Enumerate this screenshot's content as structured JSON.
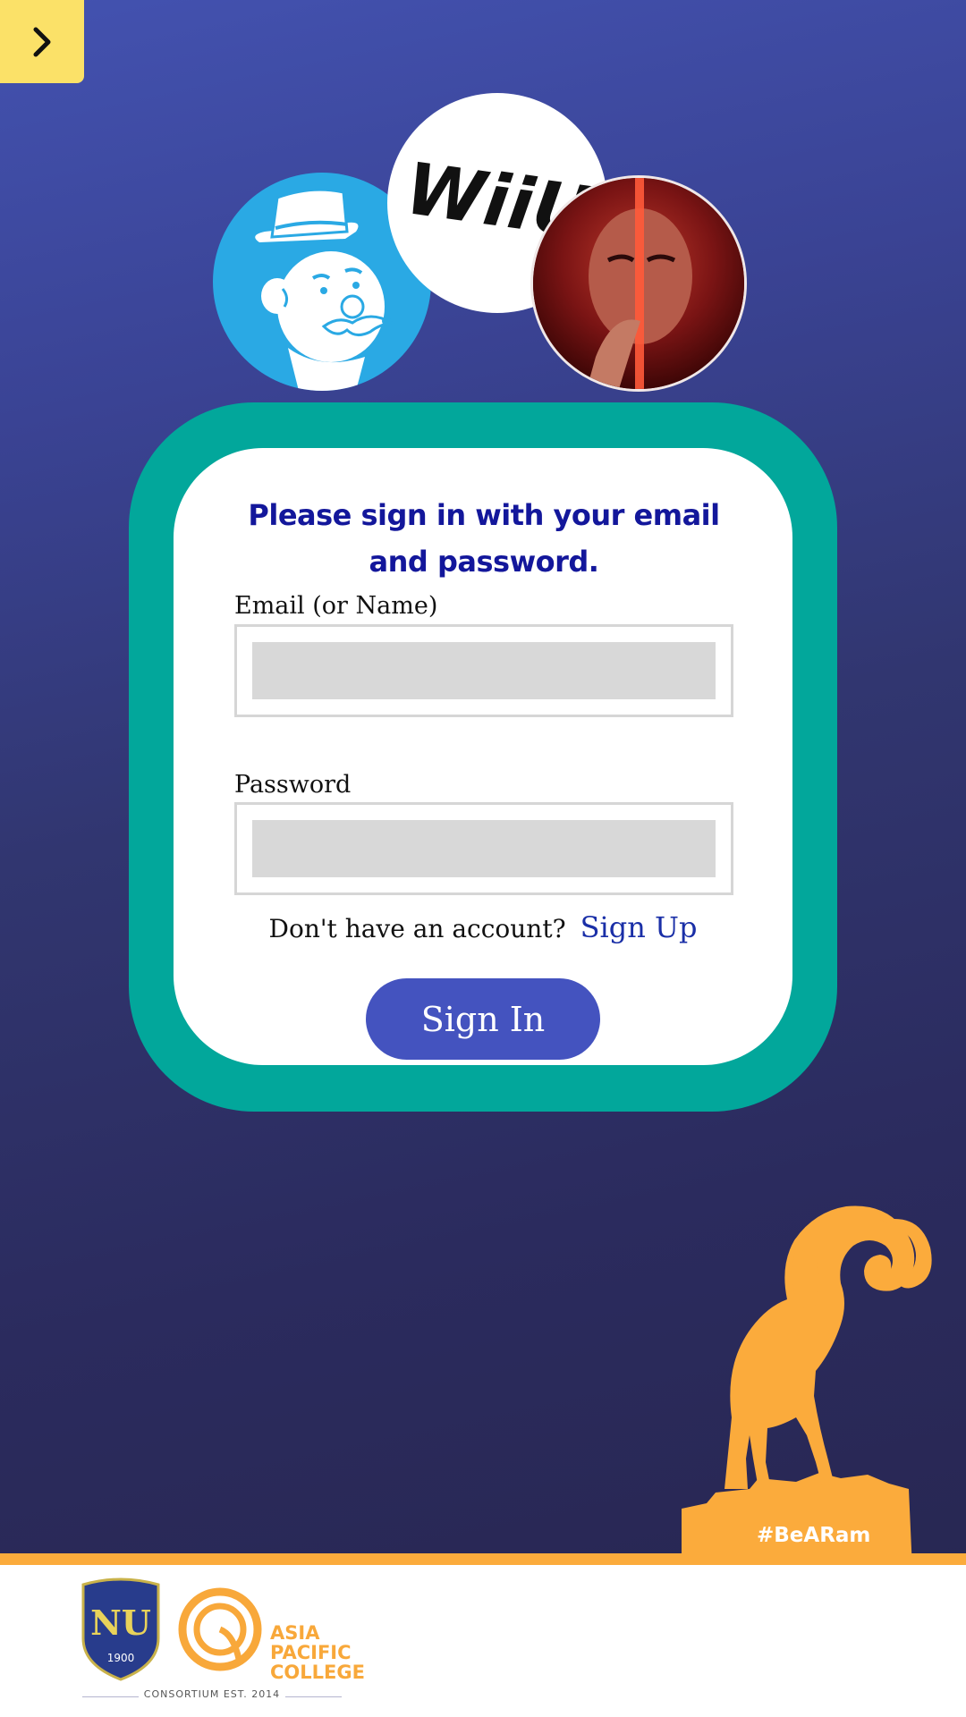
{
  "menu": {
    "icon": "chevron-right-icon"
  },
  "games": [
    {
      "name": "monopoly-icon"
    },
    {
      "label": "WiiU"
    },
    {
      "name": "tekken-icon"
    }
  ],
  "login": {
    "heading": "Please sign in with your email and password.",
    "email_label": "Email (or Name)",
    "email_value": "",
    "password_label": "Password",
    "password_value": "",
    "no_account_text": "Don't have an account?",
    "signup_link": "Sign Up",
    "signin_button": "Sign In"
  },
  "footer": {
    "hashtag": "#BeARam",
    "nu_year": "1900",
    "nu_letters": "NU",
    "apc_name": "ASIA\nPACIFIC\nCOLLEGE",
    "consortium": "CONSORTIUM EST. 2014"
  },
  "colors": {
    "accent_teal": "#02a79b",
    "button_blue": "#4453bf",
    "menu_yellow": "#fbe168",
    "ram_orange": "#fbab3c",
    "heading_blue": "#13179b"
  }
}
